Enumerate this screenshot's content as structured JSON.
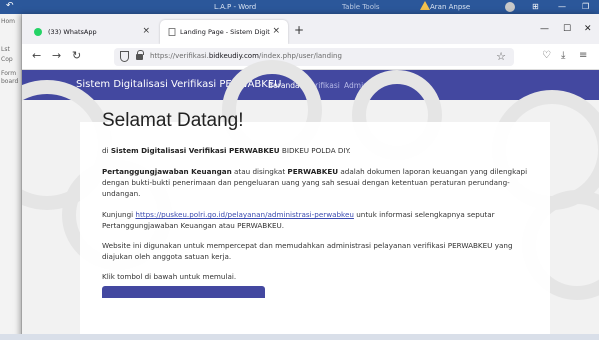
{
  "word_window": {
    "title": "L.A.P - Word",
    "tools_label": "Table Tools",
    "user_name": "Aran Anpse",
    "side_labels": [
      "Hom",
      "Lst",
      "Cop",
      "Form",
      "board"
    ]
  },
  "browser": {
    "tabs": [
      {
        "label": "(33) WhatsApp",
        "favicon": "whatsapp-icon"
      },
      {
        "label": "Landing Page - Sistem Digitalisasi V",
        "favicon": "page-icon"
      }
    ],
    "url": {
      "prefix": "https://verifikasi.",
      "domain": "bidkeudiy.com",
      "path": "/index.php/user/landing"
    }
  },
  "app": {
    "brand": "Sistem Digitalisasi Verifikasi PERWABKEU",
    "nav": [
      {
        "label": "Beranda",
        "active": true
      },
      {
        "label": "Verifikasi",
        "active": false
      },
      {
        "label": "Admin",
        "active": false
      }
    ],
    "accent_color": "#4348a0"
  },
  "content": {
    "heading": "Selamat Datang!",
    "intro": {
      "prefix": "di ",
      "bold": "Sistem Digitalisasi Verifikasi PERWABKEU",
      "suffix": " BIDKEU POLDA DIY."
    },
    "p1": {
      "bold1": "Pertanggungjawaban Keuangan",
      "mid1": " atau disingkat ",
      "bold2": "PERWABKEU",
      "rest": " adalah dokumen laporan keuangan yang dilengkapi dengan bukti-bukti penerimaan dan pengeluaran uang yang sah sesuai dengan ketentuan peraturan perundang-undangan."
    },
    "p2": {
      "prefix": "Kunjungi ",
      "link": "https://puskeu.polri.go.id/pelayanan/administrasi-perwabkeu",
      "suffix": " untuk informasi selengkapnya seputar Pertanggungjawaban Keuangan atau PERWABKEU."
    },
    "p3": "Website ini digunakan untuk mempercepat dan memudahkan administrasi pelayanan verifikasi PERWABKEU yang diajukan oleh anggota satuan kerja.",
    "p4": "Klik tombol di bawah untuk memulai."
  }
}
